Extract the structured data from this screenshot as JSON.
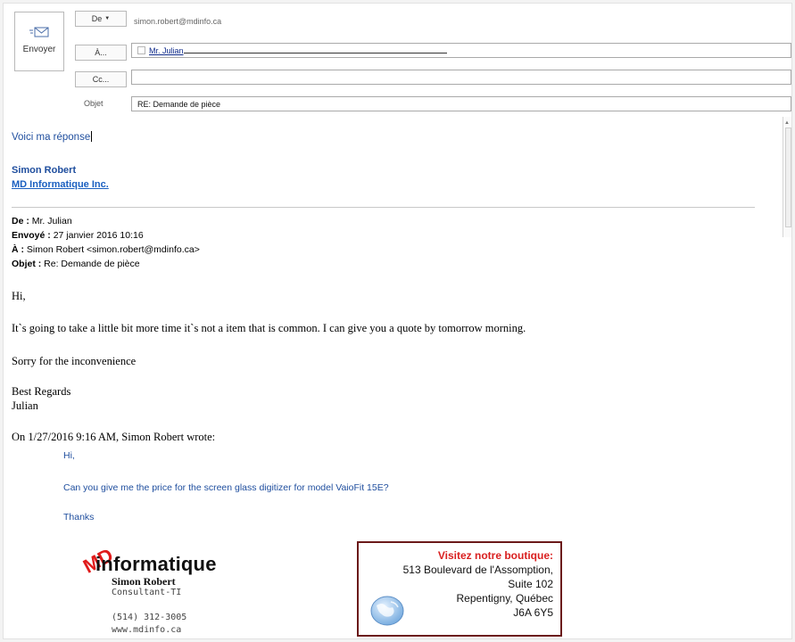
{
  "header": {
    "send_label": "Envoyer",
    "from_button": "De",
    "to_button": "À...",
    "cc_button": "Cc...",
    "subject_label": "Objet",
    "from_value": "simon.robert@mdinfo.ca",
    "to_value": "Mr. Julian",
    "cc_value": "",
    "subject_value": "RE: Demande de pièce"
  },
  "reply": {
    "text": "Voici ma réponse",
    "signature_name": "Simon Robert",
    "signature_company": "MD Informatique Inc."
  },
  "original": {
    "from_label": "De :",
    "from_value": "Mr. Julian",
    "sent_label": "Envoyé :",
    "sent_value": "27 janvier 2016 10:16",
    "to_label": "À :",
    "to_value": "Simon Robert <simon.robert@mdinfo.ca>",
    "subject_label": "Objet :",
    "subject_value": "Re: Demande de pièce",
    "greeting": "Hi,",
    "paragraph1": "It`s going to take a little bit more time it`s not a item that is common. I can give you a quote by tomorrow morning.",
    "paragraph2": "Sorry for the inconvenience",
    "closing1": "Best Regards",
    "closing2": "Julian",
    "wrote_line": "On 1/27/2016 9:16 AM, Simon Robert wrote:"
  },
  "quoted": {
    "greeting": "Hi,",
    "question": "Can you give me the price for the screen glass digitizer for model VaioFit 15E?",
    "thanks": "Thanks"
  },
  "logo_signature": {
    "brand_mark": "MD",
    "brand_word": "informatique",
    "name": "Simon Robert",
    "title": "Consultant-TI",
    "phone": "(514) 312-3005",
    "website": "www.mdinfo.ca"
  },
  "store": {
    "title": "Visitez notre boutique:",
    "line1": "513 Boulevard de l'Assomption,",
    "line2": "Suite 102",
    "line3": "Repentigny, Québec",
    "line4": "J6A 6Y5"
  },
  "colors": {
    "accent_blue": "#1f4e9e",
    "link_blue": "#1a5fc0",
    "store_red": "#d92020",
    "store_border": "#6b1a1a"
  }
}
